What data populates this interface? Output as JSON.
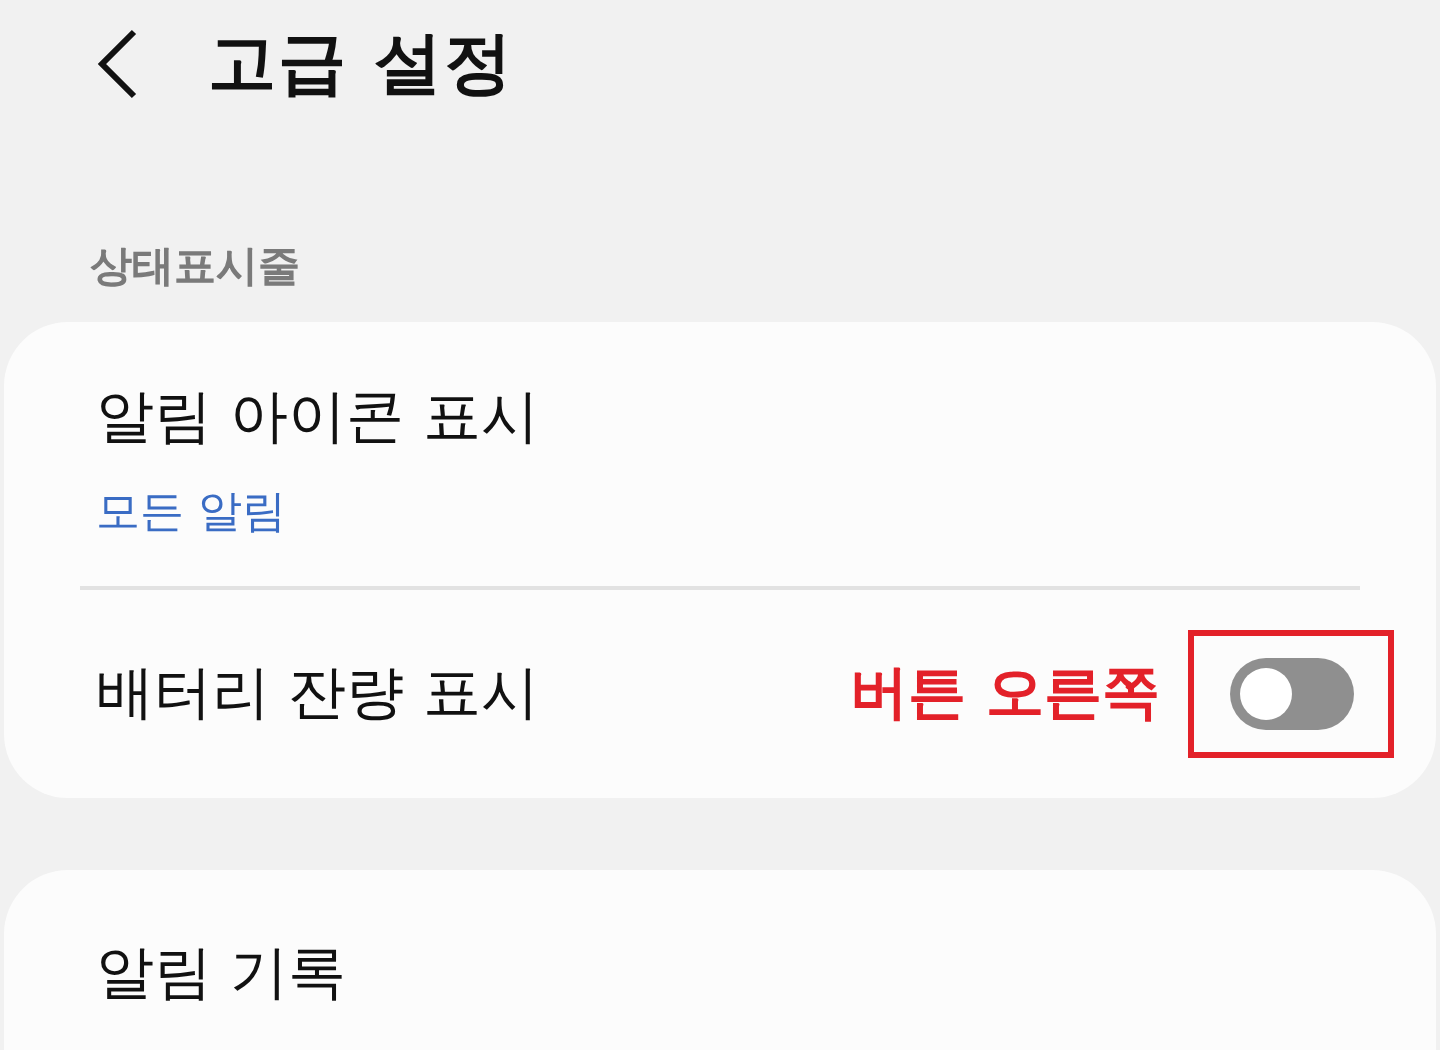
{
  "header": {
    "title": "고급 설정"
  },
  "sections": [
    {
      "label": "상태표시줄",
      "rows": [
        {
          "kind": "link",
          "title": "알림 아이콘 표시",
          "subtitle": "모든 알림"
        },
        {
          "kind": "toggle",
          "title": "배터리 잔량 표시",
          "on": false,
          "annotation": "버튼 오른쪽"
        }
      ]
    },
    {
      "rows": [
        {
          "kind": "plain",
          "title": "알림 기록"
        }
      ]
    }
  ]
}
